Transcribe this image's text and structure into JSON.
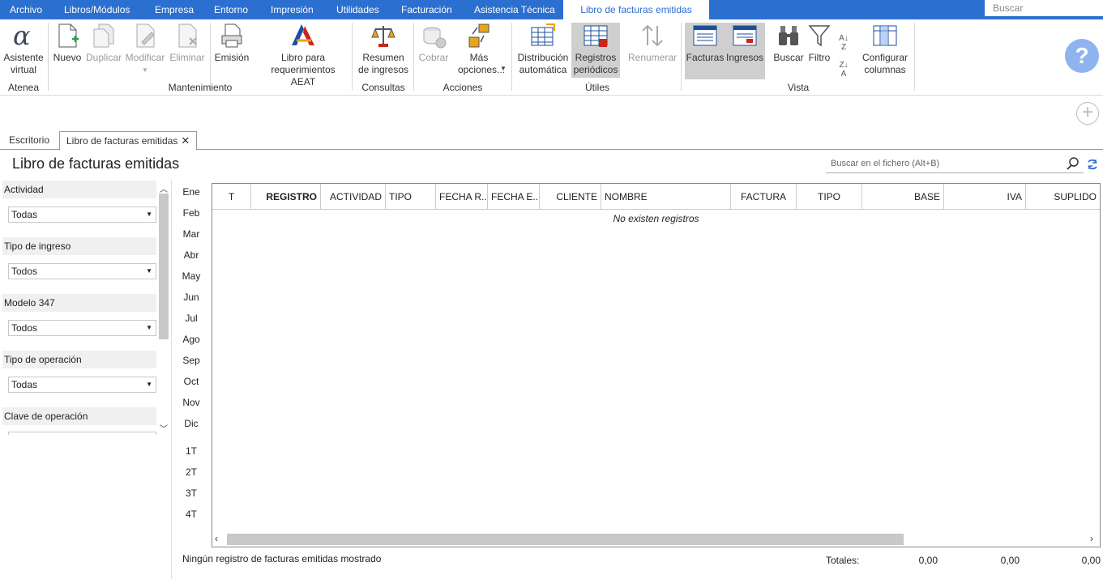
{
  "menu": {
    "items": [
      "Archivo",
      "Libros/Módulos",
      "Empresa",
      "Entorno",
      "Impresión",
      "Utilidades",
      "Facturación",
      "Asistencia Técnica"
    ],
    "active": "Libro de facturas emitidas",
    "search_placeholder": "Buscar"
  },
  "ribbon": {
    "asistente": "Asistente virtual",
    "nuevo": "Nuevo",
    "duplicar": "Duplicar",
    "modificar": "Modificar",
    "eliminar": "Eliminar",
    "emision": "Emisión",
    "libro_req": "Libro para requerimientos AEAT",
    "resumen": "Resumen de ingresos",
    "cobrar": "Cobrar",
    "mas": "Más opciones...",
    "distribucion": "Distribución automática",
    "registros": "Registros periódicos",
    "renumerar": "Renumerar",
    "facturas": "Facturas",
    "ingresos": "Ingresos",
    "buscar": "Buscar",
    "filtro": "Filtro",
    "configurar": "Configurar columnas",
    "groups": {
      "atenea": "Atenea",
      "mantenimiento": "Mantenimiento",
      "consultas": "Consultas",
      "acciones": "Acciones",
      "utiles": "Útiles",
      "vista": "Vista"
    }
  },
  "tabs": {
    "escritorio": "Escritorio",
    "libro": "Libro de facturas emitidas"
  },
  "page": {
    "title": "Libro de facturas emitidas",
    "search_placeholder": "Buscar en el fichero (Alt+B)"
  },
  "filters": [
    {
      "label": "Actividad",
      "value": "Todas"
    },
    {
      "label": "Tipo de ingreso",
      "value": "Todos"
    },
    {
      "label": "Modelo 347",
      "value": "Todos"
    },
    {
      "label": "Tipo de operación",
      "value": "Todas"
    },
    {
      "label": "Clave de operación",
      "value": ""
    }
  ],
  "months": [
    "Ene",
    "Feb",
    "Mar",
    "Abr",
    "May",
    "Jun",
    "Jul",
    "Ago",
    "Sep",
    "Oct",
    "Nov",
    "Dic"
  ],
  "quarters": [
    "1T",
    "2T",
    "3T",
    "4T"
  ],
  "grid": {
    "columns": [
      "T",
      "REGISTRO",
      "ACTIVIDAD",
      "TIPO",
      "FECHA R...",
      "FECHA E...",
      "CLIENTE",
      "NOMBRE",
      "FACTURA",
      "TIPO",
      "BASE",
      "IVA",
      "SUPLIDO"
    ],
    "empty": "No existen registros"
  },
  "status": "Ningún registro de facturas emitidas mostrado",
  "totals": {
    "label": "Totales:",
    "base": "0,00",
    "iva": "0,00",
    "suplido": "0,00"
  },
  "colors": {
    "menubar": "#2b6fd0",
    "help": "#8fb3ef"
  }
}
